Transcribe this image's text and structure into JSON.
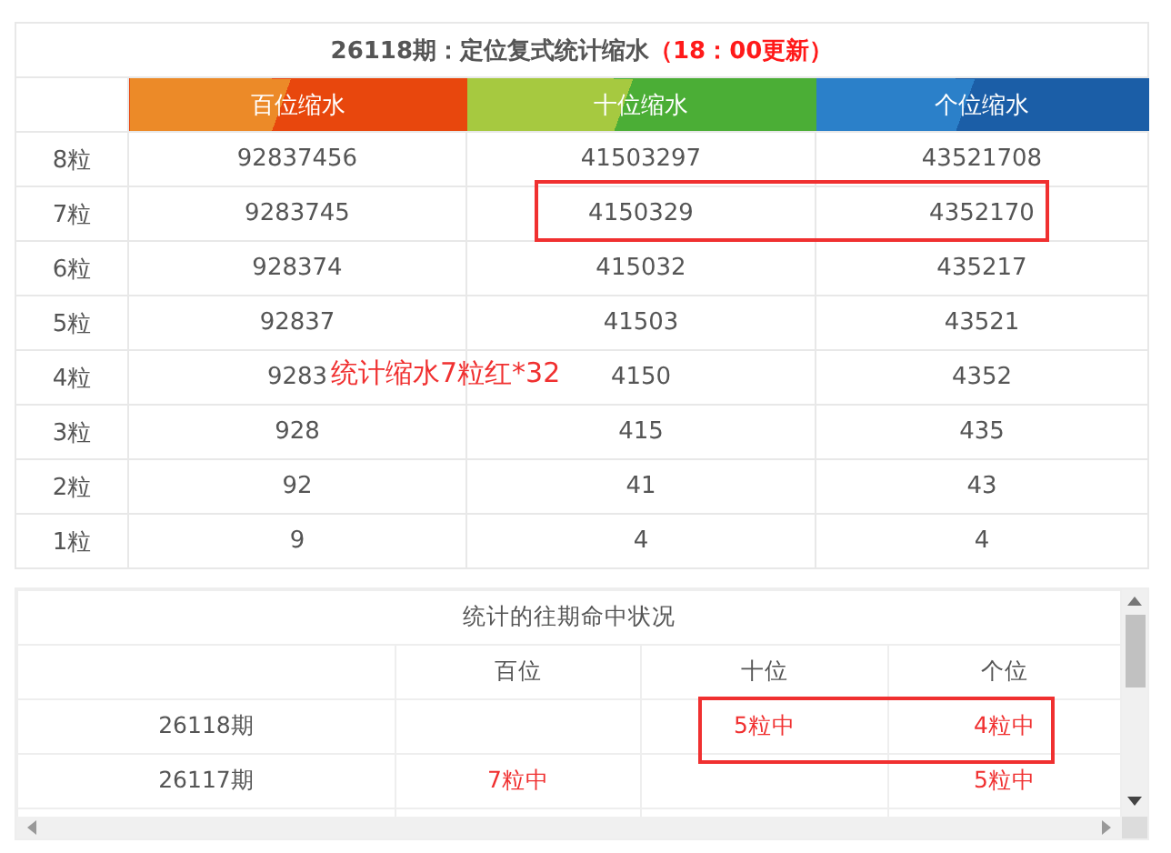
{
  "title": {
    "main": "26118期：定位复式统计缩水",
    "note": "（18：00更新）"
  },
  "columns": [
    {
      "label": "百位缩水",
      "kind": "orange"
    },
    {
      "label": "十位缩水",
      "kind": "green"
    },
    {
      "label": "个位缩水",
      "kind": "blue"
    }
  ],
  "rows": [
    {
      "label": "8粒",
      "values": [
        "92837456",
        "41503297",
        "43521708"
      ]
    },
    {
      "label": "7粒",
      "values": [
        "9283745",
        "4150329",
        "4352170"
      ]
    },
    {
      "label": "6粒",
      "values": [
        "928374",
        "415032",
        "435217"
      ]
    },
    {
      "label": "5粒",
      "values": [
        "92837",
        "41503",
        "43521"
      ]
    },
    {
      "label": "4粒",
      "values": [
        "9283",
        "4150",
        "4352"
      ]
    },
    {
      "label": "3粒",
      "values": [
        "928",
        "415",
        "435"
      ]
    },
    {
      "label": "2粒",
      "values": [
        "92",
        "41",
        "43"
      ]
    },
    {
      "label": "1粒",
      "values": [
        "9",
        "4",
        "4"
      ]
    }
  ],
  "annotation": "统计缩水7粒红*32",
  "history": {
    "title": "统计的往期命中状况",
    "columns": [
      "百位",
      "十位",
      "个位"
    ],
    "rows": [
      {
        "period": "26118期",
        "tens": "5粒中",
        "ones": "4粒中"
      },
      {
        "period": "26117期",
        "hundreds": "7粒中",
        "ones": "5粒中"
      }
    ]
  }
}
